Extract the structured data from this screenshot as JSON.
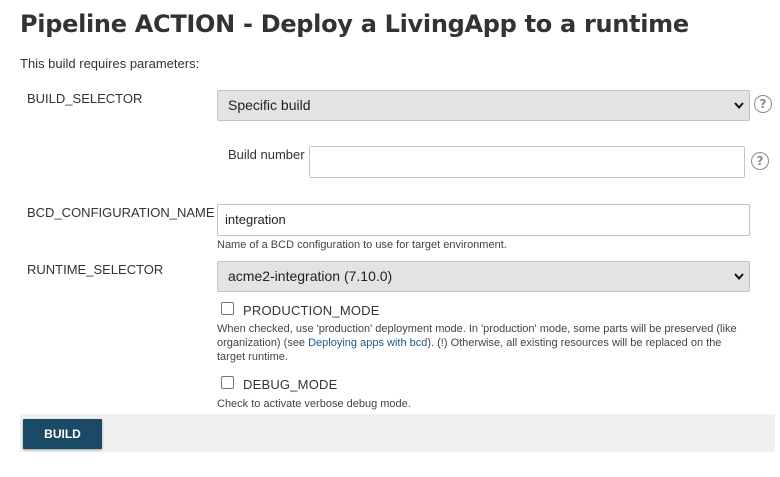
{
  "page": {
    "title": "Pipeline ACTION - Deploy a LivingApp to a runtime",
    "subtitle": "This build requires parameters:"
  },
  "params": {
    "build_selector": {
      "label": "BUILD_SELECTOR",
      "value": "Specific build",
      "build_number_label": "Build number",
      "build_number_value": ""
    },
    "bcd_configuration_name": {
      "label": "BCD_CONFIGURATION_NAME",
      "value": "integration",
      "description": "Name of a BCD configuration to use for target environment."
    },
    "runtime_selector": {
      "label": "RUNTIME_SELECTOR",
      "value": "acme2-integration (7.10.0)"
    },
    "production_mode": {
      "label": "PRODUCTION_MODE",
      "checked": false,
      "desc_part1": "When checked, use 'production' deployment mode. In 'production' mode, some parts will be preserved (like organization) (see ",
      "desc_link": "Deploying apps with bcd",
      "desc_part2": "). (!) Otherwise, all existing resources will be replaced on the target runtime."
    },
    "debug_mode": {
      "label": "DEBUG_MODE",
      "checked": false,
      "description": "Check to activate verbose debug mode."
    }
  },
  "actions": {
    "build_label": "BUILD"
  },
  "icons": {
    "help": "help-circle-icon",
    "dropdown": "chevron-down-icon"
  },
  "colors": {
    "build_button": "#1a4a66",
    "select_bg": "#e3e3e3",
    "link": "#205b8c"
  }
}
